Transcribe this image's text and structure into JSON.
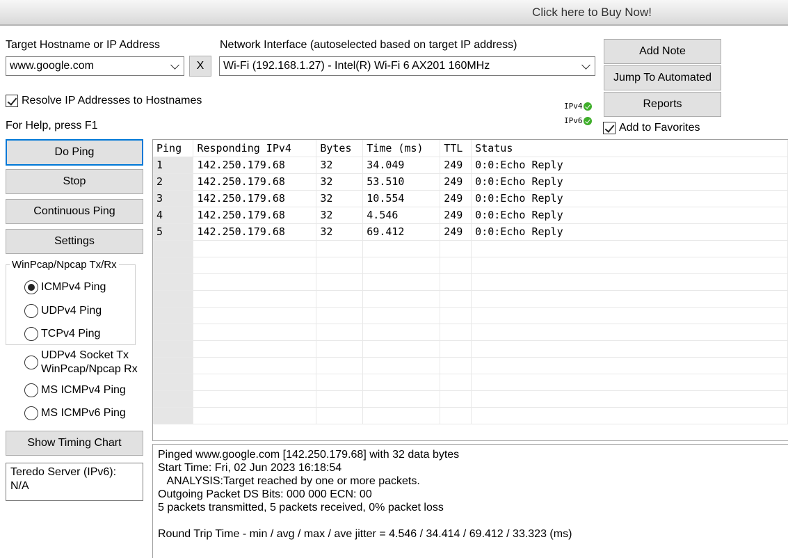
{
  "buy_bar": {
    "text": "Click here to Buy Now!"
  },
  "target": {
    "label": "Target Hostname or IP Address",
    "value": "www.google.com",
    "clear_label": "X"
  },
  "interface": {
    "label": "Network Interface (autoselected based on target IP address)",
    "value": "Wi-Fi (192.168.1.27) - Intel(R) Wi-Fi 6 AX201 160MHz"
  },
  "buttons": {
    "add_note": "Add Note",
    "jump": "Jump To Automated",
    "reports": "Reports",
    "do_ping": "Do Ping",
    "stop": "Stop",
    "continuous": "Continuous Ping",
    "settings": "Settings",
    "timing_chart": "Show Timing Chart"
  },
  "options": {
    "resolve": {
      "label": "Resolve IP Addresses to Hostnames",
      "checked": true
    },
    "favorites": {
      "label": "Add to Favorites",
      "checked": true
    },
    "help_hint": "For Help, press F1"
  },
  "ip_indicators": {
    "ipv4": {
      "label": "IPv4",
      "status": "ok",
      "icon": "check-circle-icon",
      "color": "#3fae2a"
    },
    "ipv6": {
      "label": "IPv6",
      "status": "ok",
      "icon": "check-circle-icon",
      "color": "#3fae2a"
    }
  },
  "ping_modes": {
    "group_title": "WinPcap/Npcap Tx/Rx",
    "selected": "ICMPv4 Ping",
    "items": [
      {
        "label": "ICMPv4 Ping",
        "selected": true
      },
      {
        "label": "UDPv4 Ping",
        "selected": false
      },
      {
        "label": "TCPv4 Ping",
        "selected": false
      },
      {
        "label_line1": "UDPv4 Socket Tx",
        "label_line2": "WinPcap/Npcap Rx",
        "selected": false
      },
      {
        "label": "MS ICMPv4 Ping",
        "selected": false
      },
      {
        "label": "MS ICMPv6 Ping",
        "selected": false
      }
    ]
  },
  "teredo": {
    "line1": "Teredo Server (IPv6):",
    "line2": "N/A"
  },
  "results": {
    "columns": [
      "Ping",
      "Responding IPv4",
      "Bytes",
      "Time (ms)",
      "TTL",
      "Status"
    ],
    "rows": [
      [
        "1",
        "142.250.179.68",
        "32",
        "34.049",
        "249",
        "0:0:Echo Reply"
      ],
      [
        "2",
        "142.250.179.68",
        "32",
        "53.510",
        "249",
        "0:0:Echo Reply"
      ],
      [
        "3",
        "142.250.179.68",
        "32",
        "10.554",
        "249",
        "0:0:Echo Reply"
      ],
      [
        "4",
        "142.250.179.68",
        "32",
        "4.546",
        "249",
        "0:0:Echo Reply"
      ],
      [
        "5",
        "142.250.179.68",
        "32",
        "69.412",
        "249",
        "0:0:Echo Reply"
      ]
    ]
  },
  "log": {
    "lines": [
      "Pinged www.google.com [142.250.179.68] with 32 data bytes",
      "Start Time: Fri, 02 Jun 2023 16:18:54",
      "   ANALYSIS:Target reached by one or more packets.",
      "Outgoing Packet DS Bits: 000 000 ECN: 00",
      "5 packets transmitted, 5 packets received, 0% packet loss",
      "",
      "Round Trip Time - min / avg / max / ave jitter = 4.546 / 34.414 / 69.412 / 33.323 (ms)"
    ]
  }
}
